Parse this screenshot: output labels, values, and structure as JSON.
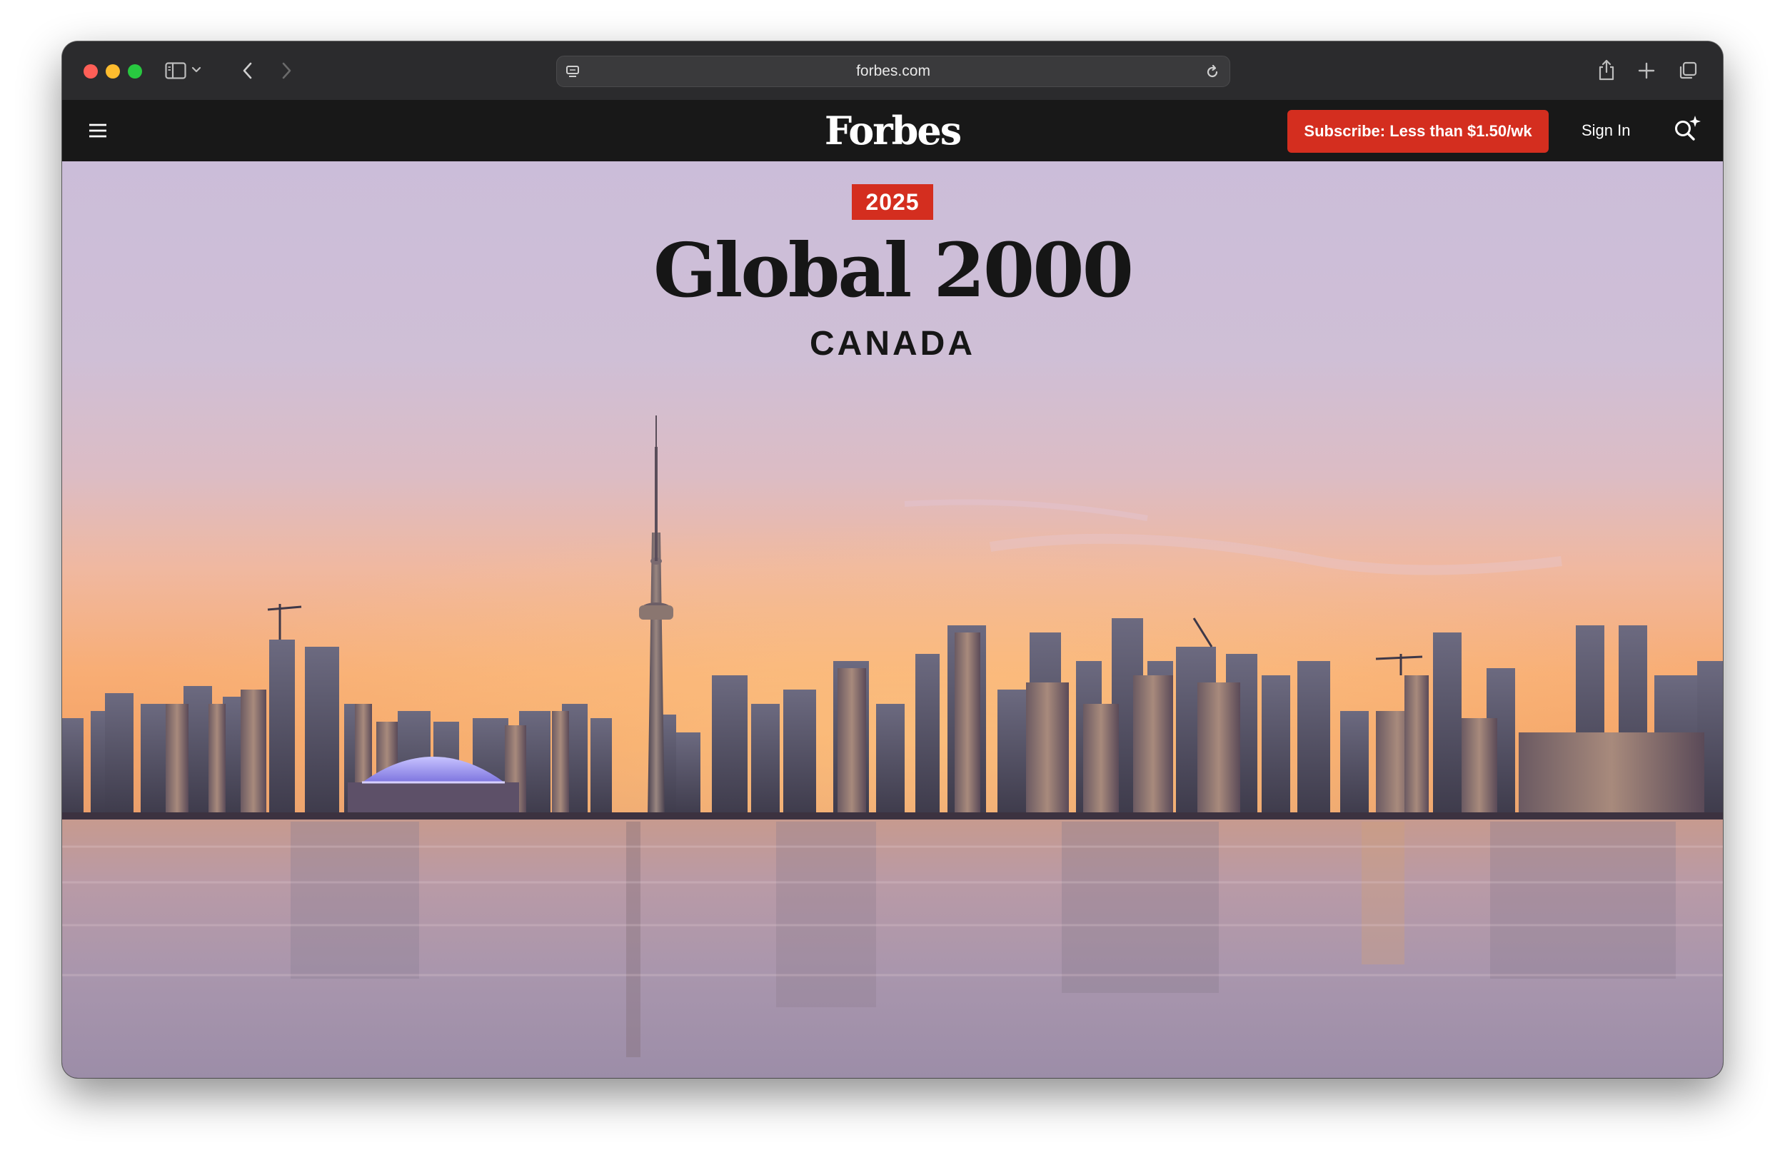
{
  "browser": {
    "url": "forbes.com",
    "icons": {
      "sidebar": "sidebar-icon",
      "sidebar_menu": "chevron-down-icon",
      "back": "chevron-left-icon",
      "forward": "chevron-right-icon",
      "page_settings": "page-settings-icon",
      "reload": "reload-icon",
      "share": "share-icon",
      "new_tab": "plus-icon",
      "tabs": "tab-overview-icon"
    }
  },
  "nav": {
    "logo": "Forbes",
    "subscribe_label": "Subscribe: Less than $1.50/wk",
    "sign_in_label": "Sign In",
    "icons": {
      "menu": "hamburger-menu-icon",
      "search": "search-sparkle-icon"
    }
  },
  "hero": {
    "year": "2025",
    "title": "Global 2000",
    "subtitle": "CANADA"
  },
  "colors": {
    "accent_red": "#d42e1f",
    "nav_bg": "#181818",
    "toolbar_bg": "#2b2b2d",
    "sky_top": "#cbbdd9",
    "sky_horizon": "#f5a86a"
  }
}
